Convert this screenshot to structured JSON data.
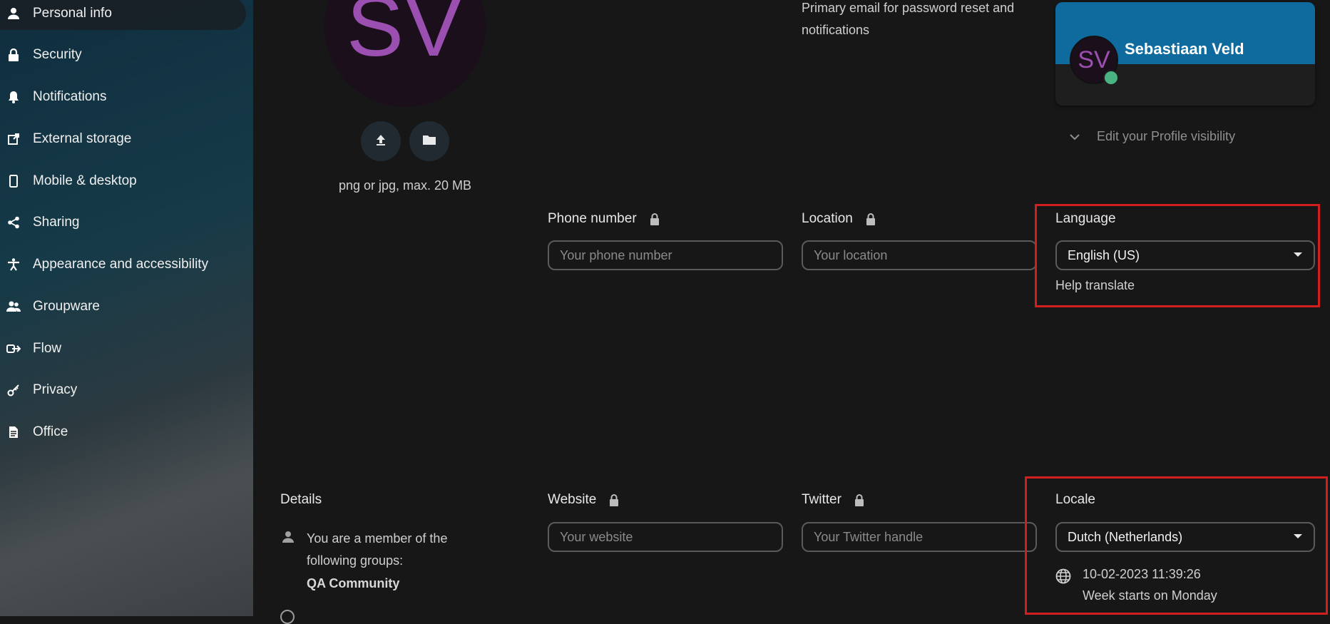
{
  "sidebar": {
    "items": [
      {
        "label": "Personal info",
        "icon": "user-icon",
        "active": true
      },
      {
        "label": "Security",
        "icon": "lock-icon"
      },
      {
        "label": "Notifications",
        "icon": "bell-icon"
      },
      {
        "label": "External storage",
        "icon": "external-link-icon"
      },
      {
        "label": "Mobile & desktop",
        "icon": "phone-icon"
      },
      {
        "label": "Sharing",
        "icon": "share-icon"
      },
      {
        "label": "Appearance and accessibility",
        "icon": "accessibility-icon"
      },
      {
        "label": "Groupware",
        "icon": "group-icon"
      },
      {
        "label": "Flow",
        "icon": "flow-icon"
      },
      {
        "label": "Privacy",
        "icon": "key-icon"
      },
      {
        "label": "Office",
        "icon": "document-icon"
      }
    ]
  },
  "avatar": {
    "initials": "SV",
    "upload_icon": "upload-icon",
    "folder_icon": "folder-icon",
    "hint": "png or jpg, max. 20 MB"
  },
  "email": {
    "help": "Primary email for password reset and notifications"
  },
  "profile_card": {
    "initials": "SV",
    "name": "Sebastiaan Veld",
    "status_color": "#49b382",
    "banner_color": "#0f6a9e"
  },
  "visibility": {
    "label": "Edit your Profile visibility"
  },
  "fields": {
    "phone": {
      "label": "Phone number",
      "placeholder": "Your phone number",
      "value": ""
    },
    "location": {
      "label": "Location",
      "placeholder": "Your location",
      "value": ""
    },
    "website": {
      "label": "Website",
      "placeholder": "Your website",
      "value": ""
    },
    "twitter": {
      "label": "Twitter",
      "placeholder": "Your Twitter handle",
      "value": ""
    }
  },
  "language": {
    "label": "Language",
    "selected": "English (US)",
    "help_link": "Help translate"
  },
  "locale": {
    "label": "Locale",
    "selected": "Dutch (Netherlands)",
    "datetime": "10-02-2023 11:39:26",
    "week_start": "Week starts on Monday"
  },
  "details": {
    "title": "Details",
    "member_text": "You are a member of the following groups:",
    "group": "QA Community"
  },
  "colors": {
    "highlight": "#d11f1f",
    "avatar_text": "#9b4fb0"
  }
}
